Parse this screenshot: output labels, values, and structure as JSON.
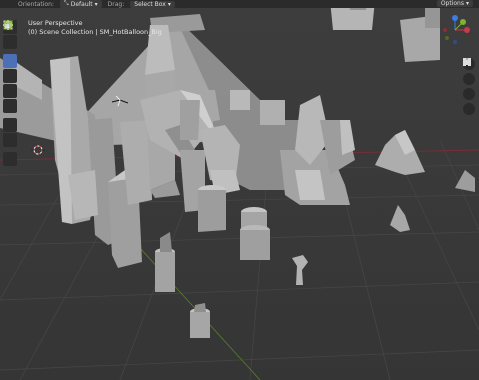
{
  "header": {
    "orientation_label": "Orientation:",
    "orientation_value": "Default",
    "drag_label": "Drag:",
    "drag_value": "Select Box",
    "options_label": "Options"
  },
  "viewport": {
    "perspective": "User Perspective",
    "collection": "(0) Scene Collection | SM_HotBalloon_Big"
  },
  "gizmo": {
    "x": "X",
    "y": "Y",
    "z": "Z"
  },
  "tools": [
    "select-box-icon",
    "cursor-icon",
    "move-icon",
    "rotate-icon",
    "scale-icon",
    "transform-icon",
    "annotate-icon",
    "measure-icon",
    "add-cube-icon"
  ],
  "nav": [
    "zoom-icon",
    "hand-icon",
    "camera-icon",
    "grid-icon"
  ],
  "colors": {
    "accent": "#4b70b8",
    "header": "#2b2b2b",
    "viewport": "#3a3a3a",
    "x_axis": "#c9384b",
    "y_axis": "#7fb32f",
    "z_axis": "#3d7ce0"
  }
}
